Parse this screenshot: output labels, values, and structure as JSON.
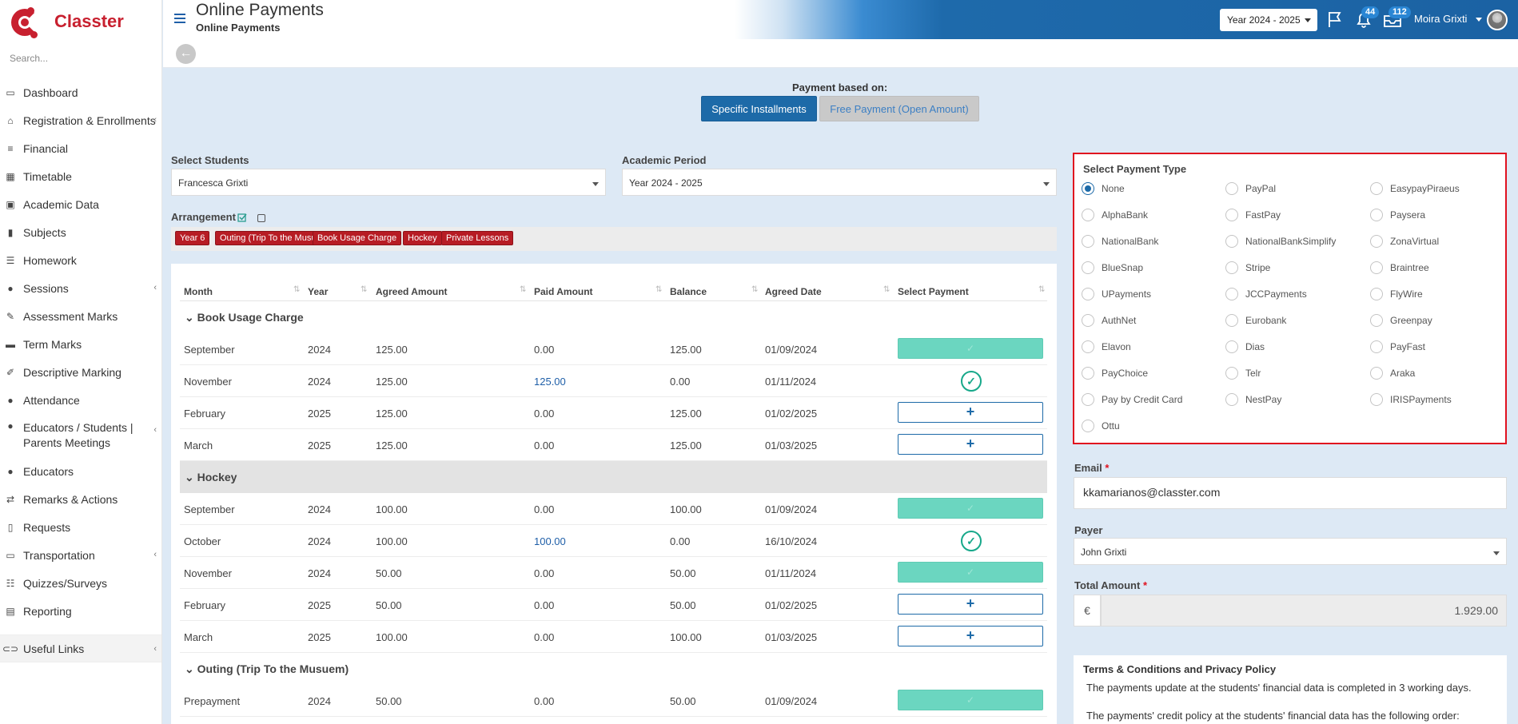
{
  "app": {
    "name": "Classter"
  },
  "sidebar": {
    "search_placeholder": "Search...",
    "items": [
      {
        "label": "Dashboard",
        "icon": "laptop-icon"
      },
      {
        "label": "Registration & Enrollments",
        "icon": "bank-icon"
      },
      {
        "label": "Financial",
        "icon": "coins-icon"
      },
      {
        "label": "Timetable",
        "icon": "calendar-icon"
      },
      {
        "label": "Academic Data",
        "icon": "person-board-icon"
      },
      {
        "label": "Subjects",
        "icon": "book-icon"
      },
      {
        "label": "Homework",
        "icon": "checklist-icon"
      },
      {
        "label": "Sessions",
        "icon": "users-icon"
      },
      {
        "label": "Assessment Marks",
        "icon": "pencil-square-icon"
      },
      {
        "label": "Term Marks",
        "icon": "card-icon"
      },
      {
        "label": "Descriptive Marking",
        "icon": "edit-icon"
      },
      {
        "label": "Attendance",
        "icon": "user-check-icon"
      },
      {
        "label": "Educators / Students | Parents Meetings",
        "icon": "meeting-icon"
      },
      {
        "label": "Educators",
        "icon": "users-icon"
      },
      {
        "label": "Remarks & Actions",
        "icon": "shuffle-icon"
      },
      {
        "label": "Requests",
        "icon": "file-icon"
      },
      {
        "label": "Transportation",
        "icon": "bus-icon"
      },
      {
        "label": "Quizzes/Surveys",
        "icon": "list-icon"
      },
      {
        "label": "Reporting",
        "icon": "printer-icon"
      }
    ],
    "useful_links": "Useful Links"
  },
  "header": {
    "title": "Online Payments",
    "subtitle": "Online Payments",
    "year_select": "Year 2024 - 2025",
    "notifications_count": "44",
    "inbox_count": "112",
    "user_name": "Moira Grixti"
  },
  "payment_based": {
    "label": "Payment based on:",
    "specific": "Specific Installments",
    "free": "Free Payment (Open Amount)"
  },
  "filters": {
    "students_label": "Select Students",
    "students_value": "Francesca Grixti",
    "period_label": "Academic Period",
    "period_value": "Year 2024 - 2025",
    "arrangement_label": "Arrangement"
  },
  "tags": [
    "Year 6",
    "Outing (Trip To the Musuem)",
    "Book Usage Charge",
    "Hockey",
    "Private Lessons"
  ],
  "table": {
    "headers": [
      "Month",
      "Year",
      "Agreed Amount",
      "Paid Amount",
      "Balance",
      "Agreed Date",
      "Select Payment"
    ],
    "groups": [
      {
        "name": "Book Usage Charge",
        "rows": [
          {
            "month": "September",
            "year": "2024",
            "agreed": "125.00",
            "paid": "0.00",
            "balance": "125.00",
            "date": "01/09/2024",
            "status": "paid"
          },
          {
            "month": "November",
            "year": "2024",
            "agreed": "125.00",
            "paid": "125.00",
            "balance": "0.00",
            "date": "01/11/2024",
            "status": "done"
          },
          {
            "month": "February",
            "year": "2025",
            "agreed": "125.00",
            "paid": "0.00",
            "balance": "125.00",
            "date": "01/02/2025",
            "status": "add"
          },
          {
            "month": "March",
            "year": "2025",
            "agreed": "125.00",
            "paid": "0.00",
            "balance": "125.00",
            "date": "01/03/2025",
            "status": "add"
          }
        ]
      },
      {
        "name": "Hockey",
        "rows": [
          {
            "month": "September",
            "year": "2024",
            "agreed": "100.00",
            "paid": "0.00",
            "balance": "100.00",
            "date": "01/09/2024",
            "status": "paid"
          },
          {
            "month": "October",
            "year": "2024",
            "agreed": "100.00",
            "paid": "100.00",
            "balance": "0.00",
            "date": "16/10/2024",
            "status": "done"
          },
          {
            "month": "November",
            "year": "2024",
            "agreed": "50.00",
            "paid": "0.00",
            "balance": "50.00",
            "date": "01/11/2024",
            "status": "paid"
          },
          {
            "month": "February",
            "year": "2025",
            "agreed": "50.00",
            "paid": "0.00",
            "balance": "50.00",
            "date": "01/02/2025",
            "status": "add"
          },
          {
            "month": "March",
            "year": "2025",
            "agreed": "100.00",
            "paid": "0.00",
            "balance": "100.00",
            "date": "01/03/2025",
            "status": "add"
          }
        ]
      },
      {
        "name": "Outing (Trip To the Musuem)",
        "rows": [
          {
            "month": "Prepayment",
            "year": "2024",
            "agreed": "50.00",
            "paid": "0.00",
            "balance": "50.00",
            "date": "01/09/2024",
            "status": "paid"
          }
        ]
      }
    ]
  },
  "payment_type": {
    "title": "Select Payment Type",
    "selected": "None",
    "options": [
      "None",
      "PayPal",
      "EasypayPiraeus",
      "AlphaBank",
      "FastPay",
      "Paysera",
      "NationalBank",
      "NationalBankSimplify",
      "ZonaVirtual",
      "BlueSnap",
      "Stripe",
      "Braintree",
      "UPayments",
      "JCCPayments",
      "FlyWire",
      "AuthNet",
      "Eurobank",
      "Greenpay",
      "Elavon",
      "Dias",
      "PayFast",
      "PayChoice",
      "Telr",
      "Araka",
      "Pay by Credit Card",
      "NestPay",
      "IRISPayments",
      "Ottu"
    ]
  },
  "form": {
    "email_label": "Email",
    "email_value": "kkamarianos@classter.com",
    "payer_label": "Payer",
    "payer_value": "John Grixti",
    "total_label": "Total Amount",
    "currency": "€",
    "total_value": "1.929.00",
    "required_mark": "*"
  },
  "terms": {
    "title": "Terms & Conditions and Privacy Policy",
    "p1": "The payments update at the students' financial data is completed in 3 working days.",
    "p2": "The payments' credit policy at the students' financial data has the following order:"
  }
}
